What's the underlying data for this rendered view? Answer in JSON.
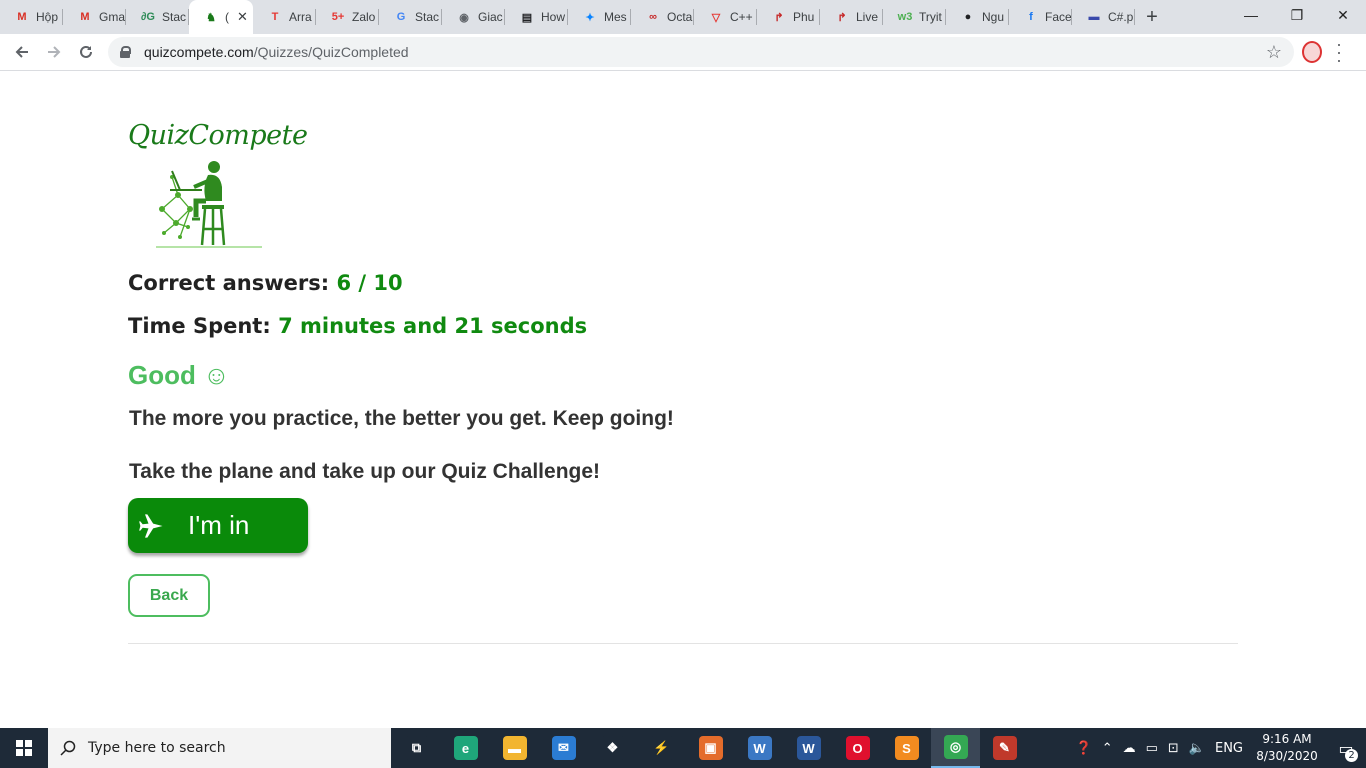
{
  "browser": {
    "tabs": [
      {
        "label": "Hộp",
        "icon": "gmail-icon",
        "glyph": "M",
        "color": "#d93025"
      },
      {
        "label": "Gma",
        "icon": "gmail-icon",
        "glyph": "M",
        "color": "#d93025"
      },
      {
        "label": "Stac",
        "icon": "stackoverflow-icon",
        "glyph": "∂G",
        "color": "#2e8b57"
      },
      {
        "label": "(",
        "icon": "quizcompete-icon",
        "glyph": "♞",
        "color": "#1a7a1a",
        "active": true
      },
      {
        "label": "Arra",
        "icon": "t-icon",
        "glyph": "T",
        "color": "#e53935"
      },
      {
        "label": "Zalo",
        "icon": "zalo-icon",
        "glyph": "5+",
        "color": "#e53935"
      },
      {
        "label": "Stac",
        "icon": "google-icon",
        "glyph": "G",
        "color": "#4285f4"
      },
      {
        "label": "Giac",
        "icon": "globe-icon",
        "glyph": "◉",
        "color": "#5f6368"
      },
      {
        "label": "How",
        "icon": "terminal-icon",
        "glyph": "▤",
        "color": "#202124"
      },
      {
        "label": "Mes",
        "icon": "messenger-icon",
        "glyph": "✦",
        "color": "#0a84ff"
      },
      {
        "label": "Octa",
        "icon": "octa-icon",
        "glyph": "∞",
        "color": "#c62828"
      },
      {
        "label": "C++",
        "icon": "c-plus-plus-icon",
        "glyph": "▽",
        "color": "#e53935"
      },
      {
        "label": "Phu",
        "icon": "redirect-icon",
        "glyph": "↱",
        "color": "#c62828"
      },
      {
        "label": "Live",
        "icon": "redirect-icon",
        "glyph": "↱",
        "color": "#c62828"
      },
      {
        "label": "Tryit",
        "icon": "w3schools-icon",
        "glyph": "w3",
        "color": "#4caf50"
      },
      {
        "label": "Ngu",
        "icon": "github-icon",
        "glyph": "●",
        "color": "#202124"
      },
      {
        "label": "Face",
        "icon": "facebook-icon",
        "glyph": "f",
        "color": "#1877f2"
      },
      {
        "label": "C#.p",
        "icon": "flag-icon",
        "glyph": "▬",
        "color": "#3949ab"
      }
    ],
    "new_tab_glyph": "+",
    "window_controls": {
      "minimize": "—",
      "maximize": "❐",
      "close": "✕"
    },
    "url": {
      "host": "quizcompete.com",
      "path": "/Quizzes/QuizCompleted"
    }
  },
  "page": {
    "logo_text": "QuizCompete",
    "correct": {
      "label": "Correct answers:",
      "value": "6 / 10"
    },
    "time": {
      "label": "Time Spent:",
      "value": "7 minutes and 21 seconds"
    },
    "rating": "Good ☺",
    "encouragement": "The more you practice, the better you get. Keep going!",
    "challenge": "Take the plane and take up our Quiz Challenge!",
    "im_in_label": "I'm in",
    "back_label": "Back",
    "colors": {
      "brand_green": "#108a10",
      "light_green": "#4dbd5f"
    }
  },
  "taskbar": {
    "search_placeholder": "Type here to search",
    "apps": [
      {
        "name": "task-view-icon",
        "glyph": "⧉",
        "color": "#1e2a38"
      },
      {
        "name": "edge-icon",
        "glyph": "e",
        "color": "#1fa67a"
      },
      {
        "name": "file-explorer-icon",
        "glyph": "▬",
        "color": "#f2b530"
      },
      {
        "name": "mail-icon",
        "glyph": "✉",
        "color": "#2b7cd3"
      },
      {
        "name": "dropbox-icon",
        "glyph": "❖",
        "color": "#1e2a38"
      },
      {
        "name": "visual-studio-icon",
        "glyph": "⚡",
        "color": "#1e2a38"
      },
      {
        "name": "presentation-icon",
        "glyph": "▣",
        "color": "#e46c2b"
      },
      {
        "name": "word-template-icon",
        "glyph": "W",
        "color": "#3b78c4"
      },
      {
        "name": "word-icon",
        "glyph": "W",
        "color": "#2b579a"
      },
      {
        "name": "opera-icon",
        "glyph": "O",
        "color": "#e0102e"
      },
      {
        "name": "sublime-text-icon",
        "glyph": "S",
        "color": "#f28b20"
      },
      {
        "name": "chrome-icon",
        "glyph": "◎",
        "color": "#34a853",
        "active": true
      },
      {
        "name": "paint-icon",
        "glyph": "✎",
        "color": "#c0392b"
      }
    ],
    "tray": {
      "lang": "ENG",
      "time": "9:16 AM",
      "date": "8/30/2020",
      "notifications": "2"
    }
  }
}
